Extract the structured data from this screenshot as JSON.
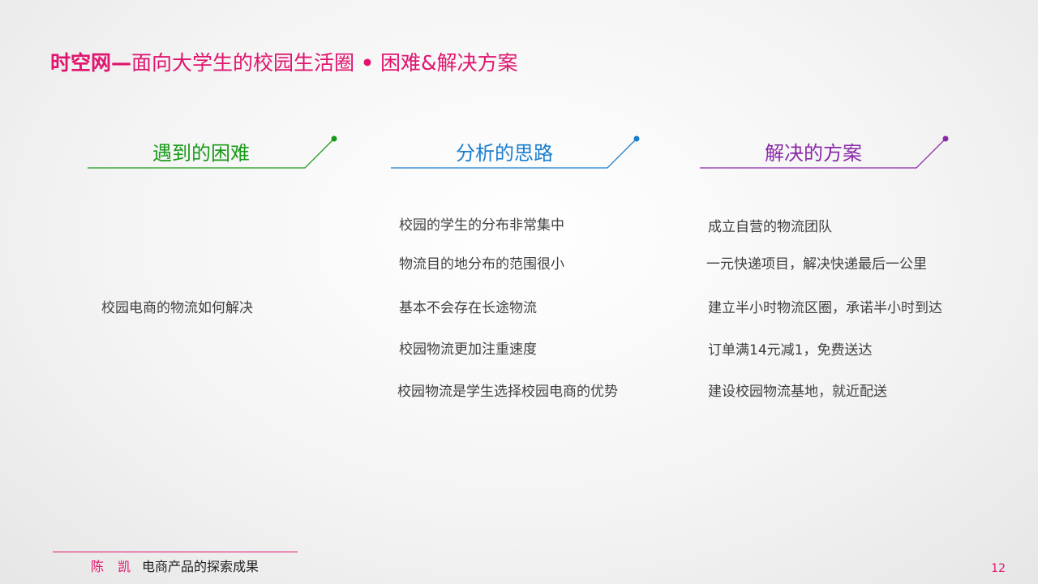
{
  "title": {
    "brand": "时空网",
    "dash": "—",
    "subtitle": "面向大学生的校园生活圈",
    "dot": "•",
    "section": "困难&解决方案"
  },
  "columns": [
    {
      "heading": "遇到的困难",
      "color": "#1a9a1a",
      "items": [
        "校园电商的物流如何解决"
      ]
    },
    {
      "heading": "分析的思路",
      "color": "#1a7ed0",
      "items": [
        "校园的学生的分布非常集中",
        "物流目的地分布的范围很小",
        "基本不会存在长途物流",
        "校园物流更加注重速度",
        "校园物流是学生选择校园电商的优势"
      ]
    },
    {
      "heading": "解决的方案",
      "color": "#8a2aa8",
      "items": [
        "成立自营的物流团队",
        "一元快递项目，解决快递最后一公里",
        "建立半小时物流区圈，承诺半小时到达",
        "订单满14元减1，免费送达",
        "建设校园物流基地，就近配送"
      ]
    }
  ],
  "footer": {
    "author": "陈 凯",
    "subtitle": "电商产品的探索成果",
    "page_number": "12",
    "accent_color": "#e0146e"
  }
}
